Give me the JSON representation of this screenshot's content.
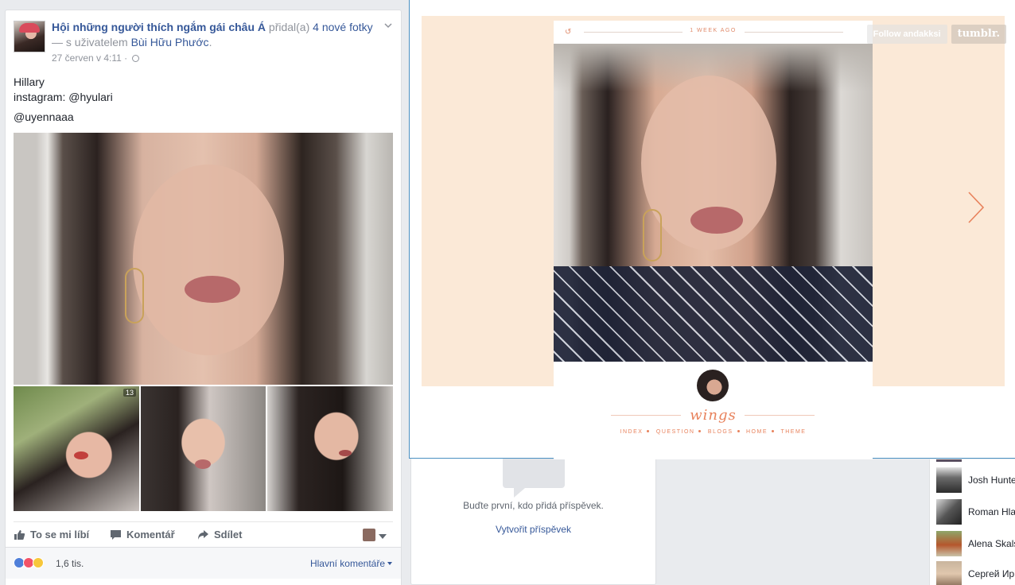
{
  "post": {
    "group_name": "Hội những người thích ngắm gái châu Á",
    "added_text": " přidal(a) ",
    "photos_link": "4 nové fotky",
    "with_text": "— s uživatelem ",
    "with_user": "Bùi Hữu Phước",
    "period": ".",
    "timestamp": "27 červen v 4:11 · ",
    "lines": [
      "Hillary",
      "instagram: @hyulari",
      "@uyennaaa"
    ],
    "thumb_badge": "13"
  },
  "actions": {
    "like": "To se mi líbí",
    "comment": "Komentář",
    "share": "Sdílet"
  },
  "reactions": {
    "count": "1,6 tis.",
    "sort_label": "Hlavní komentáře"
  },
  "create_post": {
    "prompt": "Buďte první, kdo přidá příspěvek.",
    "link": "Vytvořit příspěvek"
  },
  "people": [
    {
      "name": "Josh Hunte"
    },
    {
      "name": "Roman Hla"
    },
    {
      "name": "Alena Skals"
    },
    {
      "name": "Сергей Ир"
    }
  ],
  "tumblr": {
    "time_label": "1 WEEK AGO",
    "follow_button": "Follow andakksi",
    "brand_button": "tumblr.",
    "blog_title": "wings",
    "nav": [
      "INDEX",
      "QUESTION",
      "BLOGS",
      "HOME",
      "THEME"
    ]
  },
  "colors": {
    "fb_link": "#365899",
    "tumblr_accent": "#e8825c",
    "tumblr_bg": "#fbe9d7"
  }
}
